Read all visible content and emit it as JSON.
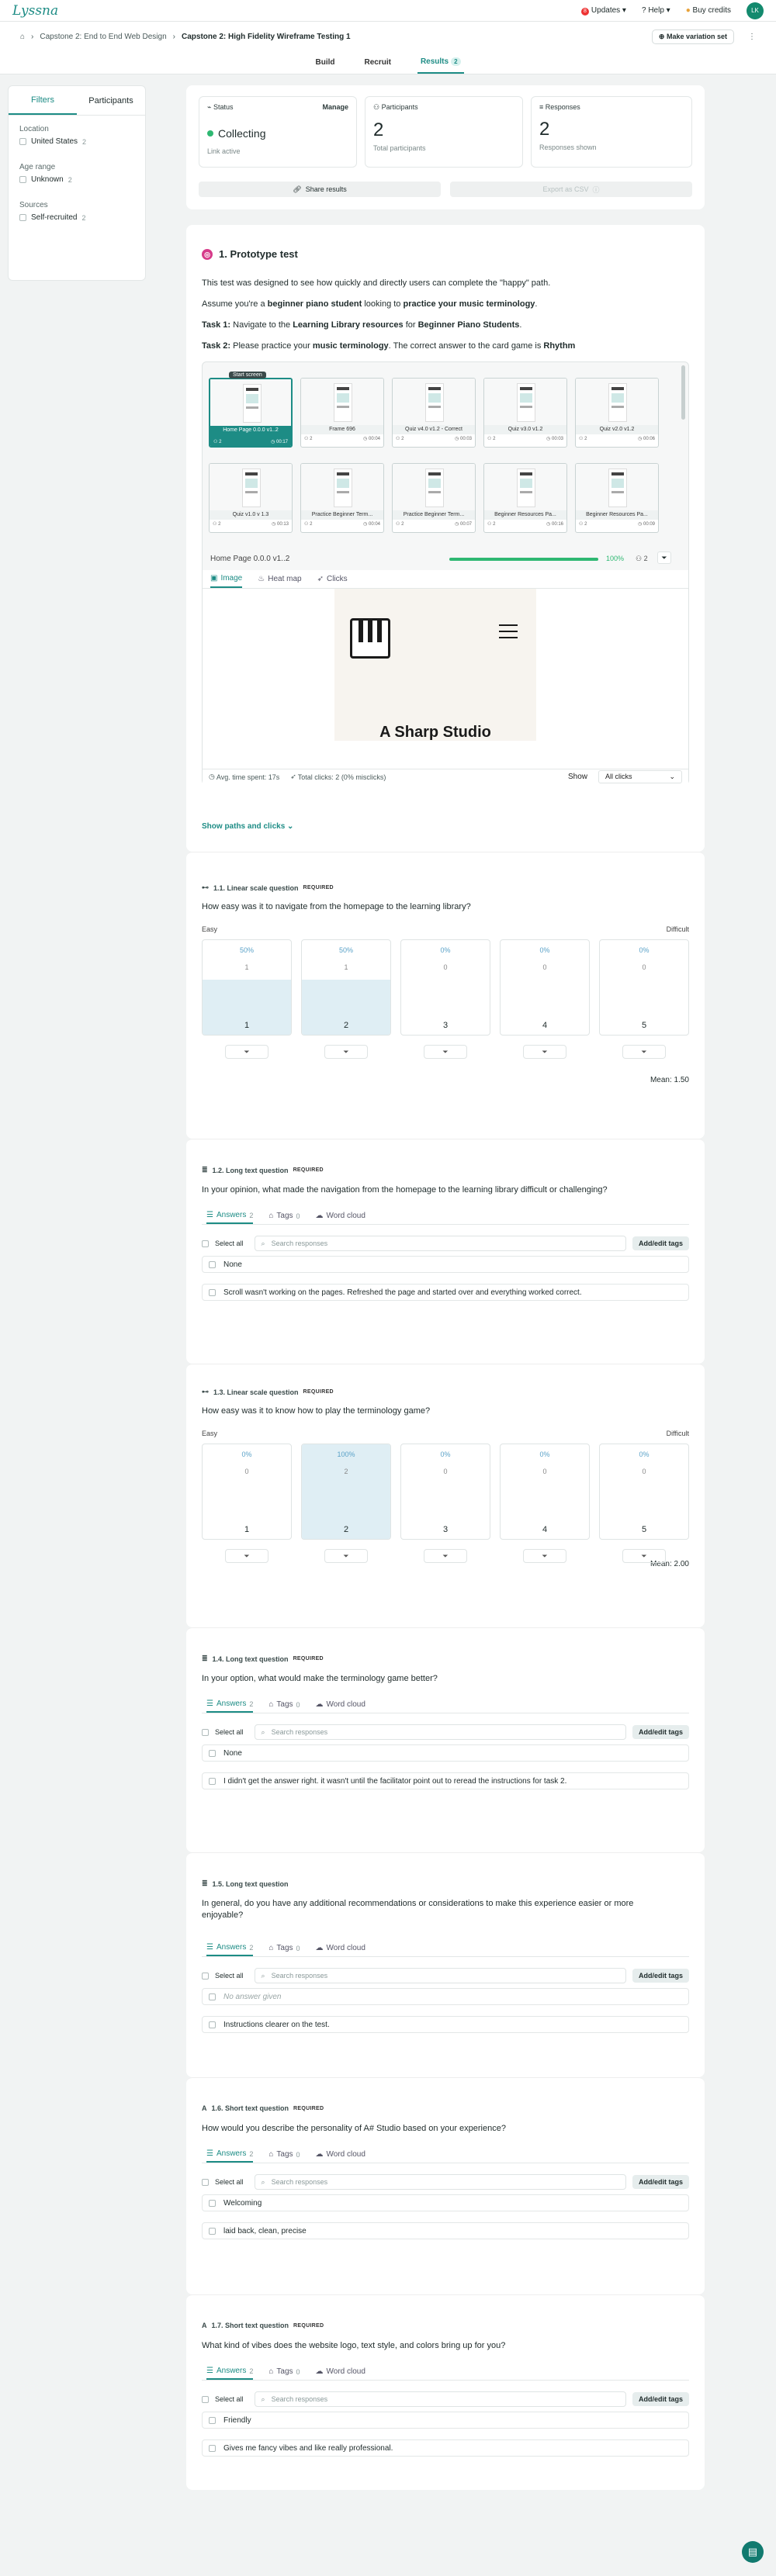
{
  "app": {
    "logo": "Lyssna",
    "updates": "Updates",
    "updates_badge": "8",
    "help": "Help",
    "buy_credits": "Buy credits",
    "avatar_initials": "LK"
  },
  "breadcrumb": {
    "parent": "Capstone 2: End to End Web Design",
    "current": "Capstone 2: High Fidelity Wireframe Testing 1",
    "variation": "Make variation set"
  },
  "tabs": {
    "build": "Build",
    "recruit": "Recruit",
    "results": "Results",
    "results_count": "2"
  },
  "sidebar": {
    "tab_filters": "Filters",
    "tab_participants": "Participants",
    "groups": [
      {
        "label": "Location",
        "option": "United States",
        "count": "2"
      },
      {
        "label": "Age range",
        "option": "Unknown",
        "count": "2"
      },
      {
        "label": "Sources",
        "option": "Self-recruited",
        "count": "2"
      }
    ]
  },
  "stats": {
    "status_title": "Status",
    "manage": "Manage",
    "status_value": "Collecting",
    "status_sub": "Link active",
    "participants_title": "Participants",
    "participants_value": "2",
    "participants_sub": "Total participants",
    "responses_title": "Responses",
    "responses_value": "2",
    "responses_sub": "Responses shown",
    "share": "Share results",
    "export": "Export as CSV"
  },
  "prototype": {
    "title": "1. Prototype test",
    "intro": "This test was designed to see how quickly and directly users can complete the \"happy\" path.",
    "assume_a": "Assume you're a ",
    "assume_b": "beginner piano student",
    "assume_c": " looking to ",
    "assume_d": "practice your music terminology",
    "task1_a": "Task 1:",
    "task1_b": " Navigate to the ",
    "task1_c": "Learning Library resources",
    "task1_d": " for ",
    "task1_e": "Beginner Piano Students",
    "task2_a": "Task 2:",
    "task2_b": " Please practice your ",
    "task2_c": "music terminology",
    "task2_d": ". The correct answer to the card game is ",
    "task2_e": "Rhythm",
    "start_screen": "Start screen",
    "frames": [
      {
        "name": "Home Page 0.0.0 v1..2",
        "n": "2",
        "t": "00:17"
      },
      {
        "name": "Frame 696",
        "n": "2",
        "t": "00:04"
      },
      {
        "name": "Quiz v4.0 v1.2 - Correct",
        "n": "2",
        "t": "00:03"
      },
      {
        "name": "Quiz v3.0 v1.2",
        "n": "2",
        "t": "00:03"
      },
      {
        "name": "Quiz v2.0 v1.2",
        "n": "2",
        "t": "00:06"
      },
      {
        "name": "Quiz v1.0 v 1.3",
        "n": "2",
        "t": "00:13"
      },
      {
        "name": "Practice Beginner Term...",
        "n": "2",
        "t": "00:04"
      },
      {
        "name": "Practice Beginner Term...",
        "n": "2",
        "t": "00:07"
      },
      {
        "name": "Beginner Resources Pa...",
        "n": "2",
        "t": "00:16"
      },
      {
        "name": "Beginner Resources Pa...",
        "n": "2",
        "t": "00:09"
      }
    ],
    "current_frame": "Home Page 0.0.0 v1..2",
    "progress_pct": "100%",
    "progress_value": 1.0,
    "people": "2",
    "view_tabs": [
      "Image",
      "Heat map",
      "Clicks"
    ],
    "preview_text": "A Sharp Studio",
    "avg_time": "Avg. time spent: 17s",
    "total_clicks": "Total clicks: 2 (0% misclicks)",
    "show_label": "Show",
    "show_value": "All clicks",
    "paths_link": "Show paths and clicks"
  },
  "q11": {
    "num": "1.1. Linear scale question",
    "req": "REQUIRED",
    "text": "How easy was it to navigate from the homepage to the learning library?",
    "low": "Easy",
    "high": "Difficult",
    "scale": [
      {
        "label": "1",
        "pct": "50%",
        "n": "1",
        "share": 0.5
      },
      {
        "label": "2",
        "pct": "50%",
        "n": "1",
        "share": 0.5
      },
      {
        "label": "3",
        "pct": "0%",
        "n": "0",
        "share": 0
      },
      {
        "label": "4",
        "pct": "0%",
        "n": "0",
        "share": 0
      },
      {
        "label": "5",
        "pct": "0%",
        "n": "0",
        "share": 0
      }
    ],
    "mean": "Mean: 1.50"
  },
  "q12": {
    "num": "1.2. Long text question",
    "req": "REQUIRED",
    "text": "In your opinion, what made the navigation from the homepage to the learning library difficult or challenging?",
    "tab_answers": "Answers",
    "answers_count": "2",
    "tab_tags": "Tags",
    "tags_count": "0",
    "tab_cloud": "Word cloud",
    "select_all": "Select all",
    "search_placeholder": "Search responses",
    "add_tags": "Add/edit tags",
    "responses": [
      "None",
      "Scroll wasn't working on the pages. Refreshed the page and started over and everything worked correct."
    ]
  },
  "q13": {
    "num": "1.3. Linear scale question",
    "req": "REQUIRED",
    "text": "How easy was it to know how to play the terminology game?",
    "low": "Easy",
    "high": "Difficult",
    "scale": [
      {
        "label": "1",
        "pct": "0%",
        "n": "0",
        "share": 0
      },
      {
        "label": "2",
        "pct": "100%",
        "n": "2",
        "share": 1
      },
      {
        "label": "3",
        "pct": "0%",
        "n": "0",
        "share": 0
      },
      {
        "label": "4",
        "pct": "0%",
        "n": "0",
        "share": 0
      },
      {
        "label": "5",
        "pct": "0%",
        "n": "0",
        "share": 0
      }
    ],
    "mean": "Mean: 2.00"
  },
  "q14": {
    "num": "1.4. Long text question",
    "req": "REQUIRED",
    "text": "In your option, what would make the terminology game better?",
    "tab_answers": "Answers",
    "answers_count": "2",
    "tab_tags": "Tags",
    "tags_count": "0",
    "tab_cloud": "Word cloud",
    "select_all": "Select all",
    "search_placeholder": "Search responses",
    "add_tags": "Add/edit tags",
    "responses": [
      "None",
      "I didn't get the answer right. it wasn't until the facilitator point out to reread the instructions for task 2."
    ]
  },
  "q15": {
    "num": "1.5. Long text question",
    "req": "",
    "text": "In general, do you have any additional recommendations or considerations to make this experience easier or more enjoyable?",
    "tab_answers": "Answers",
    "answers_count": "2",
    "tab_tags": "Tags",
    "tags_count": "0",
    "tab_cloud": "Word cloud",
    "select_all": "Select all",
    "search_placeholder": "Search responses",
    "add_tags": "Add/edit tags",
    "responses": [
      "No answer given",
      "Instructions clearer on the test."
    ]
  },
  "q16": {
    "num": "1.6. Short text question",
    "req": "REQUIRED",
    "text": "How would you describe the personality of A# Studio based on your experience?",
    "tab_answers": "Answers",
    "answers_count": "2",
    "tab_tags": "Tags",
    "tags_count": "0",
    "tab_cloud": "Word cloud",
    "select_all": "Select all",
    "search_placeholder": "Search responses",
    "add_tags": "Add/edit tags",
    "responses": [
      "Welcoming",
      "laid back, clean, precise"
    ]
  },
  "q17": {
    "num": "1.7. Short text question",
    "req": "REQUIRED",
    "text": "What kind of vibes does the website logo, text style, and colors bring up for you?",
    "tab_answers": "Answers",
    "answers_count": "2",
    "tab_tags": "Tags",
    "tags_count": "0",
    "tab_cloud": "Word cloud",
    "select_all": "Select all",
    "search_placeholder": "Search responses",
    "add_tags": "Add/edit tags",
    "responses": [
      "Friendly",
      "Gives me fancy vibes and like really professional."
    ]
  },
  "colors": {
    "brand": "#1d8c85",
    "status_green": "#2eb872"
  }
}
